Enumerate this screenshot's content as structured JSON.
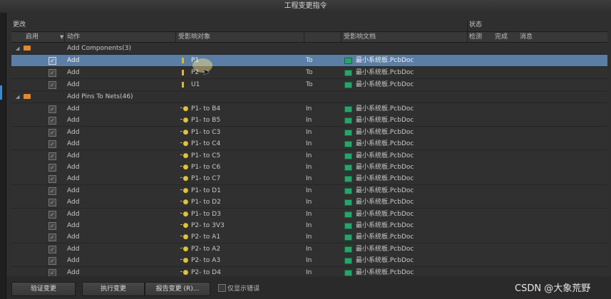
{
  "window": {
    "title": "工程变更指令"
  },
  "section": {
    "left_label": "更改",
    "right_label": "状态"
  },
  "columns": {
    "enable": "启用",
    "action": "动作",
    "affected_object": "受影响对象",
    "affected_document": "受影响文档",
    "check": "检测",
    "done": "完成",
    "message": "消息"
  },
  "groups": [
    {
      "label": "Add Components(3)"
    },
    {
      "label": "Add Pins To Nets(46)"
    }
  ],
  "component_rows": [
    {
      "action": "Add",
      "object": "P1",
      "dir": "To",
      "doc": "最小系统板.PcbDoc",
      "checked": "✓",
      "selected": true
    },
    {
      "action": "Add",
      "object": "P2",
      "dir": "To",
      "doc": "最小系统板.PcbDoc",
      "checked": "✓",
      "selected": false
    },
    {
      "action": "Add",
      "object": "U1",
      "dir": "To",
      "doc": "最小系统板.PcbDoc",
      "checked": "✓",
      "selected": false
    }
  ],
  "pin_rows": [
    {
      "action": "Add",
      "object": "P1- to B4",
      "dir": "In",
      "doc": "最小系统板.PcbDoc",
      "checked": "✓"
    },
    {
      "action": "Add",
      "object": "P1- to B5",
      "dir": "In",
      "doc": "最小系统板.PcbDoc",
      "checked": "✓"
    },
    {
      "action": "Add",
      "object": "P1- to C3",
      "dir": "In",
      "doc": "最小系统板.PcbDoc",
      "checked": "✓"
    },
    {
      "action": "Add",
      "object": "P1- to C4",
      "dir": "In",
      "doc": "最小系统板.PcbDoc",
      "checked": "✓"
    },
    {
      "action": "Add",
      "object": "P1- to C5",
      "dir": "In",
      "doc": "最小系统板.PcbDoc",
      "checked": "✓"
    },
    {
      "action": "Add",
      "object": "P1- to C6",
      "dir": "In",
      "doc": "最小系统板.PcbDoc",
      "checked": "✓"
    },
    {
      "action": "Add",
      "object": "P1- to C7",
      "dir": "In",
      "doc": "最小系统板.PcbDoc",
      "checked": "✓"
    },
    {
      "action": "Add",
      "object": "P1- to D1",
      "dir": "In",
      "doc": "最小系统板.PcbDoc",
      "checked": "✓"
    },
    {
      "action": "Add",
      "object": "P1- to D2",
      "dir": "In",
      "doc": "最小系统板.PcbDoc",
      "checked": "✓"
    },
    {
      "action": "Add",
      "object": "P1- to D3",
      "dir": "In",
      "doc": "最小系统板.PcbDoc",
      "checked": "✓"
    },
    {
      "action": "Add",
      "object": "P2- to 3V3",
      "dir": "In",
      "doc": "最小系统板.PcbDoc",
      "checked": "✓"
    },
    {
      "action": "Add",
      "object": "P2- to A1",
      "dir": "In",
      "doc": "最小系统板.PcbDoc",
      "checked": "✓"
    },
    {
      "action": "Add",
      "object": "P2- to A2",
      "dir": "In",
      "doc": "最小系统板.PcbDoc",
      "checked": "✓"
    },
    {
      "action": "Add",
      "object": "P2- to A3",
      "dir": "In",
      "doc": "最小系统板.PcbDoc",
      "checked": "✓"
    },
    {
      "action": "Add",
      "object": "P2- to D4",
      "dir": "In",
      "doc": "最小系统板.PcbDoc",
      "checked": "✓"
    }
  ],
  "buttons": {
    "validate": "验证变更",
    "execute": "执行变更",
    "report": "报告变更 (R)...",
    "only_errors": "仅显示错误"
  },
  "watermark": "CSDN @大象荒野",
  "colors": {
    "selected_row": "#5b7ea6",
    "folder": "#e0892e",
    "pcb_icon": "#2aa36b",
    "component_icon": "#e2b33a"
  }
}
